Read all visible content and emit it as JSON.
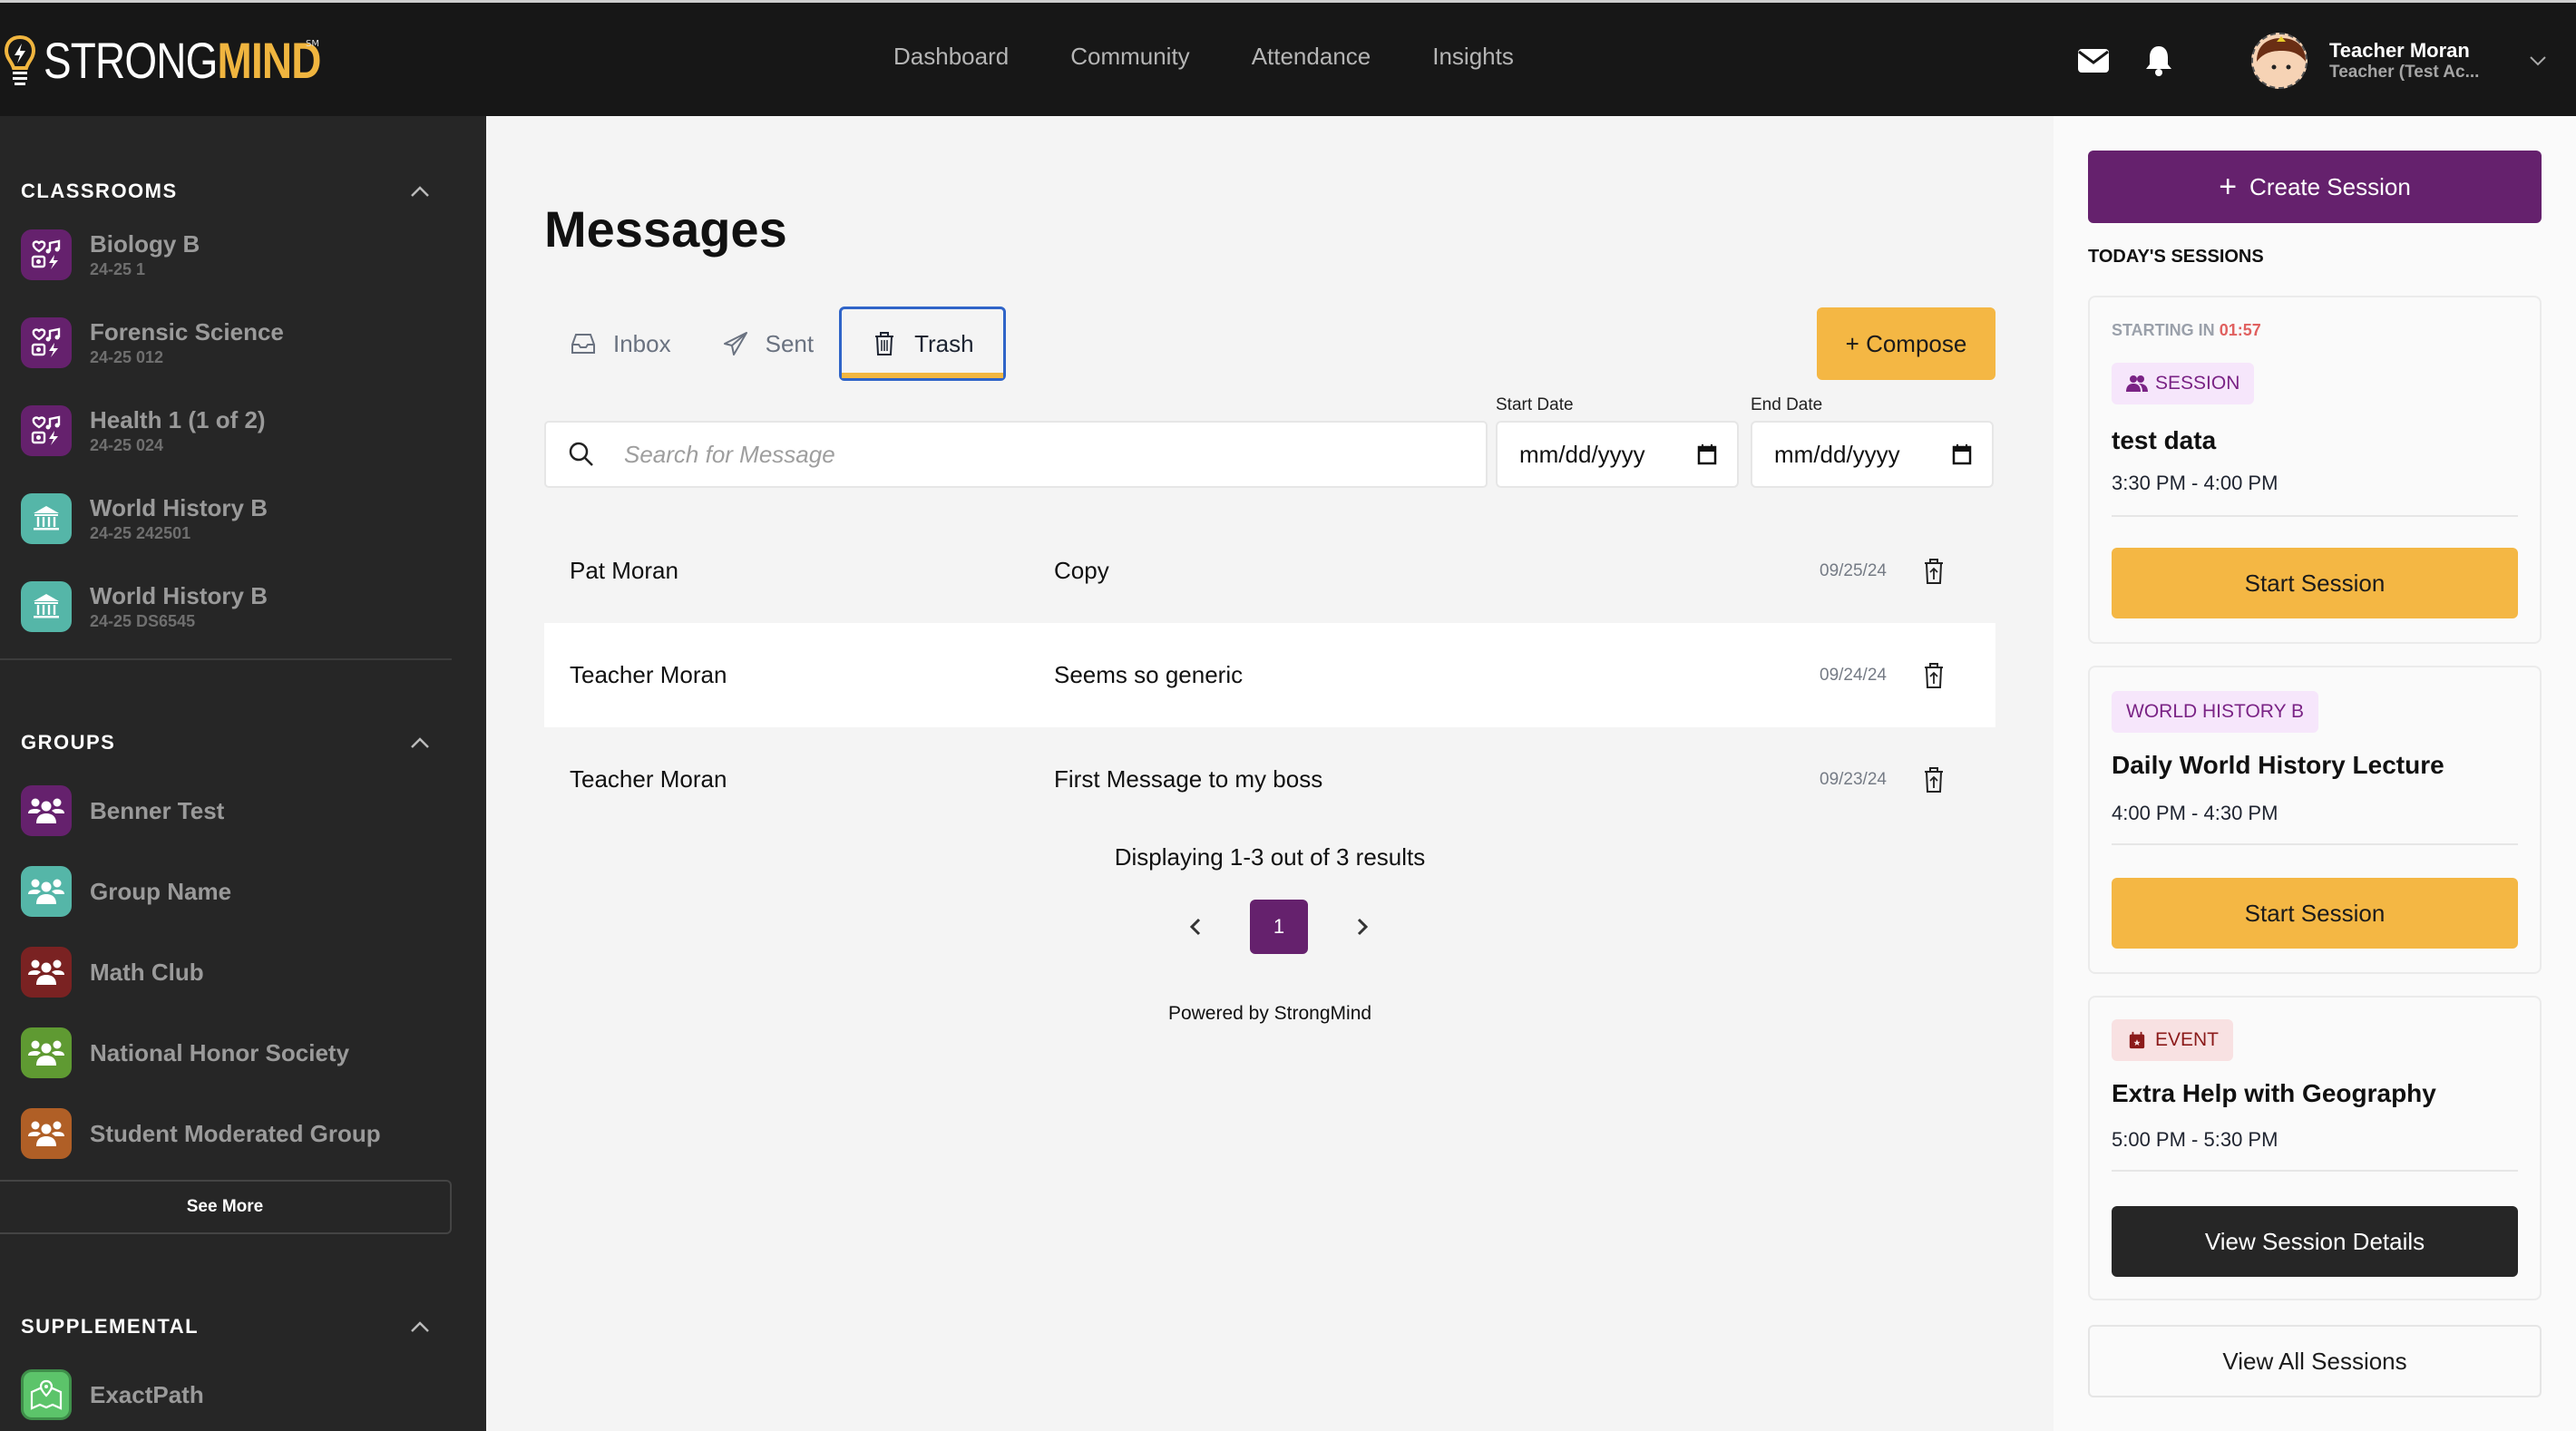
{
  "brand": {
    "name_part1": "STRONG",
    "name_part2": "MIND",
    "mark": "SM"
  },
  "colors": {
    "brand_yellow": "#f4b744",
    "brand_purple": "#65216d",
    "header_bg": "#171717",
    "sidebar_bg": "#262626",
    "countdown_red": "#e0605f",
    "active_tab_border": "#2f64c8"
  },
  "nav": [
    "Dashboard",
    "Community",
    "Attendance",
    "Insights"
  ],
  "header": {
    "icons": [
      "mail-icon",
      "bell-icon"
    ],
    "user": {
      "name": "Teacher Moran",
      "role": "Teacher (Test Ac..."
    }
  },
  "sidebar": {
    "classrooms": {
      "title": "CLASSROOMS",
      "items": [
        {
          "name": "Biology B",
          "code": "24-25 1",
          "icon": "electives-icon",
          "color": "#65216d"
        },
        {
          "name": "Forensic Science",
          "code": "24-25 012",
          "icon": "electives-icon",
          "color": "#65216d"
        },
        {
          "name": "Health 1 (1 of 2)",
          "code": "24-25 024",
          "icon": "electives-icon",
          "color": "#65216d"
        },
        {
          "name": "World History B",
          "code": "24-25 242501",
          "icon": "landmark-icon",
          "color": "#55b6a8"
        },
        {
          "name": "World History B",
          "code": "24-25 DS6545",
          "icon": "landmark-icon",
          "color": "#55b6a8"
        }
      ]
    },
    "groups": {
      "title": "GROUPS",
      "items": [
        {
          "name": "Benner Test",
          "color": "#65216d"
        },
        {
          "name": "Group Name",
          "color": "#55b6a8"
        },
        {
          "name": "Math Club",
          "color": "#7a2222"
        },
        {
          "name": "National Honor Society",
          "color": "#5f9a32"
        },
        {
          "name": "Student Moderated Group",
          "color": "#b05f26"
        }
      ],
      "see_more": "See More"
    },
    "supplemental": {
      "title": "SUPPLEMENTAL",
      "items": [
        {
          "name": "ExactPath",
          "icon": "map-pin-icon",
          "color": "#5cc46a"
        }
      ]
    }
  },
  "main": {
    "title": "Messages",
    "tabs": [
      {
        "label": "Inbox",
        "icon": "inbox-icon",
        "active": false
      },
      {
        "label": "Sent",
        "icon": "send-icon",
        "active": false
      },
      {
        "label": "Trash",
        "icon": "trash-icon",
        "active": true
      }
    ],
    "compose_label": "+ Compose",
    "search_placeholder": "Search for Message",
    "start_date": {
      "label": "Start Date",
      "value": "mm/dd/yyyy"
    },
    "end_date": {
      "label": "End Date",
      "value": "mm/dd/yyyy"
    },
    "messages": [
      {
        "from": "Pat Moran",
        "subject": "Copy",
        "date": "09/25/24"
      },
      {
        "from": "Teacher Moran",
        "subject": "Seems so generic",
        "date": "09/24/24"
      },
      {
        "from": "Teacher Moran",
        "subject": "First Message to my boss",
        "date": "09/23/24"
      }
    ],
    "display_text": "Displaying 1-3 out of 3 results",
    "current_page": "1",
    "powered_by": "Powered by StrongMind"
  },
  "right_panel": {
    "create_label": "Create Session",
    "today_title": "TODAY'S SESSIONS",
    "sessions": [
      {
        "starting_label": "STARTING IN",
        "countdown": "01:57",
        "badge": "SESSION",
        "badge_type": "purple",
        "title": "test data",
        "time": "3:30 PM - 4:00 PM",
        "action": "Start Session"
      },
      {
        "badge": "WORLD HISTORY B",
        "badge_type": "purple",
        "title": "Daily World History Lecture",
        "time": "4:00 PM - 4:30 PM",
        "action": "Start Session"
      },
      {
        "badge": "EVENT",
        "badge_type": "red",
        "title": "Extra Help with Geography",
        "time": "5:00 PM - 5:30 PM",
        "action": "View Session Details"
      }
    ],
    "view_all_label": "View All Sessions"
  }
}
